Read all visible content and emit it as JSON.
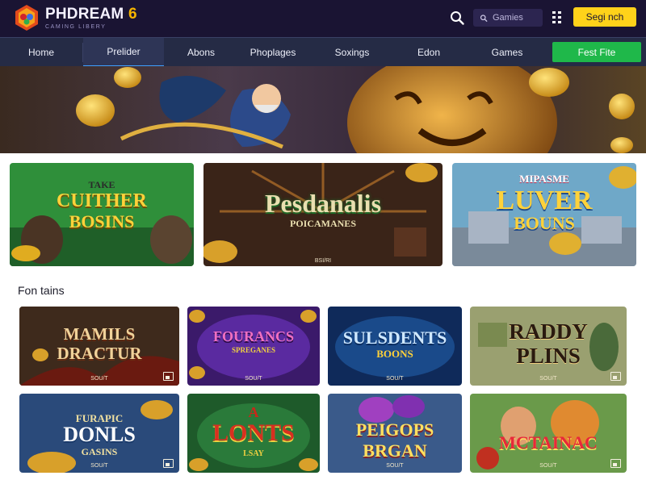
{
  "header": {
    "logo_title": "PHDREAM",
    "logo_number": "6",
    "logo_subtitle": "CAMING LIBERY",
    "search_placeholder": "Gamies",
    "signin_label": "Segi nch"
  },
  "nav": {
    "items": [
      {
        "label": "Home"
      },
      {
        "label": "Prelider"
      },
      {
        "label": "Abons"
      },
      {
        "label": "Phoplages"
      },
      {
        "label": "Soxings"
      },
      {
        "label": "Edon"
      },
      {
        "label": "Games"
      }
    ],
    "cta_label": "Fest Fite"
  },
  "promos": [
    {
      "line1": "TAKE",
      "line2": "CUITHER",
      "line3": "BOSINS",
      "tag": ""
    },
    {
      "line1": "Pesdanalis",
      "line2": "POICAMANES",
      "tag": "BSI/RI"
    },
    {
      "line1": "MIPASME",
      "line2": "LUVER",
      "line3": "BOUNS",
      "tag": ""
    }
  ],
  "section": {
    "title": "Fon tains"
  },
  "games": [
    {
      "line1": "MAMILS",
      "line2": "DRACTUR",
      "tag": "SOU/T"
    },
    {
      "line1": "FOURANCS",
      "line2": "SPREGANES",
      "tag": "SOU/T"
    },
    {
      "line1": "SULSDENTS",
      "line2": "BOONS",
      "tag": "SOU/T"
    },
    {
      "line1": "RADDY",
      "line2": "PLINS",
      "tag": "SOU/T"
    },
    {
      "line1": "FURAPIC",
      "line2": "DONLS",
      "line3": "GASINS",
      "tag": "SOU/T"
    },
    {
      "line1": "A",
      "line2": "LONTS",
      "line3": "LSAY",
      "tag": ""
    },
    {
      "line1": "PEIGOPS",
      "line2": "BRGAN",
      "tag": "SOU/T"
    },
    {
      "line1": "MCTAINAC",
      "tag": "SOU/T"
    }
  ],
  "colors": {
    "header_bg": "#1a1433",
    "nav_bg": "#252b45",
    "signin_bg": "#ffd21a",
    "cta_bg": "#1fb84a",
    "nav_active_underline": "#3fa0ff"
  }
}
